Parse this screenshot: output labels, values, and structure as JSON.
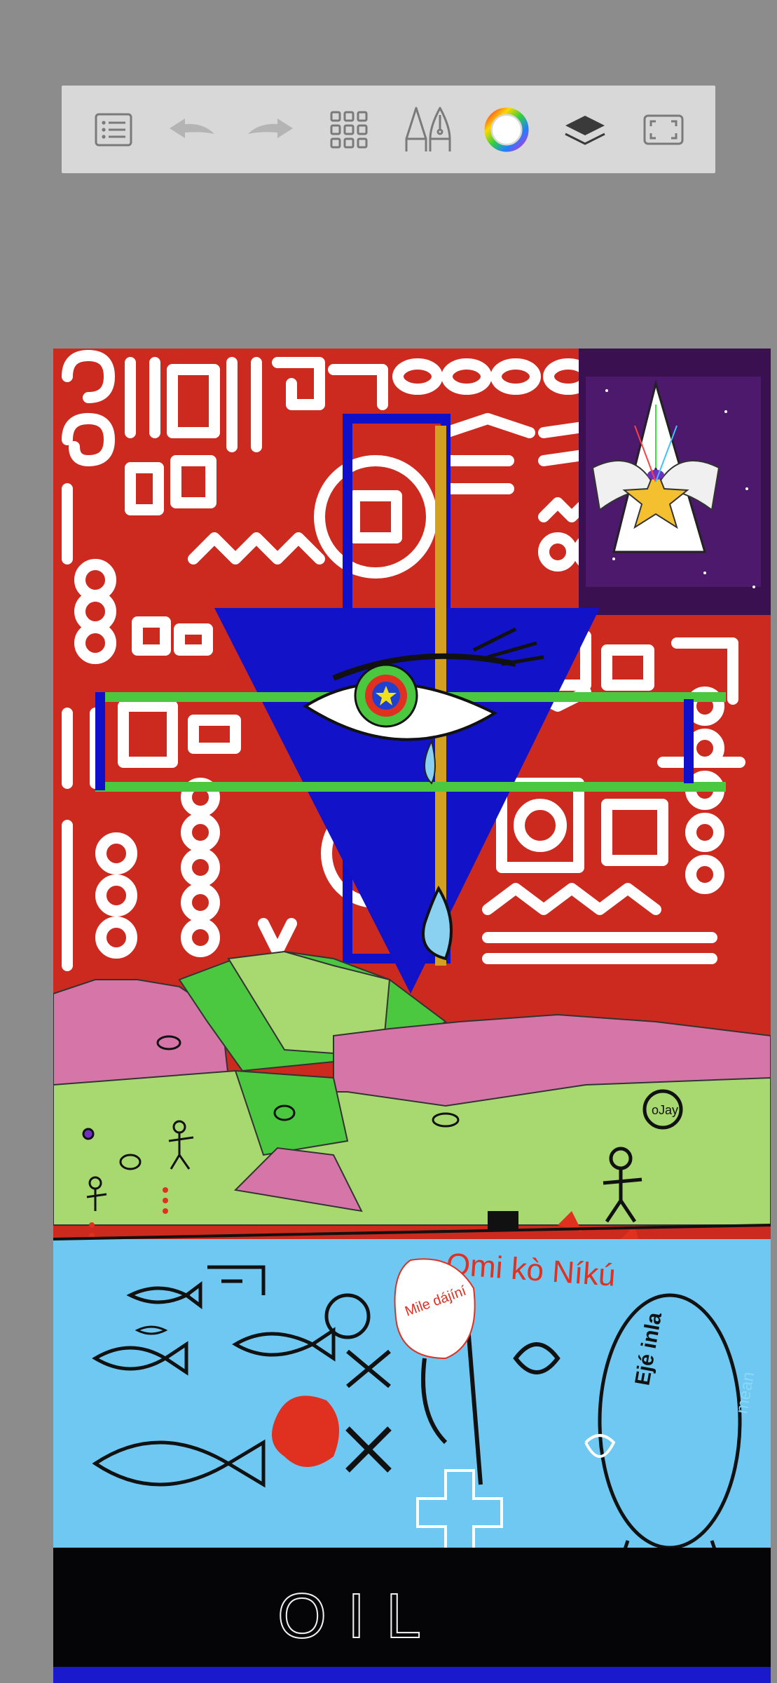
{
  "toolbar": {
    "buttons": [
      {
        "name": "gallery-list-button",
        "icon": "list-icon"
      },
      {
        "name": "undo-button",
        "icon": "undo-arrow-icon"
      },
      {
        "name": "redo-button",
        "icon": "redo-arrow-icon"
      },
      {
        "name": "brush-library-button",
        "icon": "grid-icon"
      },
      {
        "name": "brush-tools-button",
        "icon": "pencil-pen-icon"
      },
      {
        "name": "color-picker-button",
        "icon": "color-wheel-icon"
      },
      {
        "name": "layers-button",
        "icon": "layers-icon"
      },
      {
        "name": "fullscreen-button",
        "icon": "fullscreen-icon"
      }
    ]
  },
  "artwork": {
    "colors": {
      "background_red": "#cc2a1e",
      "pattern_white": "#ffffff",
      "triangle_blue": "#1010c8",
      "cross_green": "#4cc840",
      "gold_bar": "#d4a020",
      "hill_pink": "#d676a8",
      "hill_green": "#a8d870",
      "water_blue": "#6ec8f2",
      "night_black": "#050508",
      "space_purple": "#4a1a6a"
    },
    "texts": {
      "water_caption": "Omi kò Níkú",
      "fish_label": "Ejé inla",
      "bubble_label": "Mile dájíní",
      "love_label": "mean",
      "person_tag": "oJay",
      "bottom_label": "OIL"
    }
  }
}
